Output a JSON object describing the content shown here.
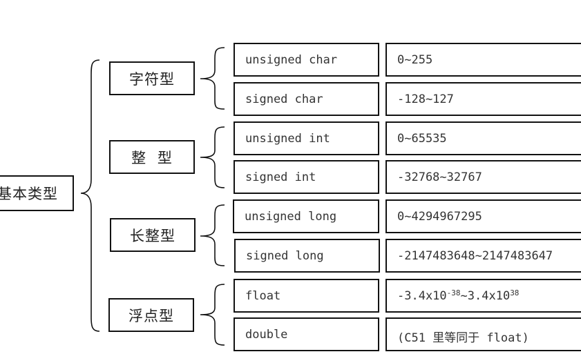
{
  "root": {
    "label": "基本类型"
  },
  "categories": [
    {
      "label": "字符型",
      "types": [
        {
          "name": "unsigned char",
          "range": "0~255"
        },
        {
          "name": "signed char",
          "range": "-128~127"
        }
      ]
    },
    {
      "label": "整 型",
      "types": [
        {
          "name": "unsigned int",
          "range": "0~65535"
        },
        {
          "name": "signed int",
          "range": "-32768~32767"
        }
      ]
    },
    {
      "label": "长整型",
      "types": [
        {
          "name": "unsigned long",
          "range": "0~4294967295"
        },
        {
          "name": "signed long",
          "range": "-2147483648~2147483647"
        }
      ]
    },
    {
      "label": "浮点型",
      "types": [
        {
          "name": "float",
          "range_base1": "-3.4x10",
          "range_exp1": "-38",
          "range_mid": "~3.4x10",
          "range_exp2": "38"
        },
        {
          "name": "double",
          "range": "(C51 里等同于 float)"
        }
      ]
    }
  ]
}
